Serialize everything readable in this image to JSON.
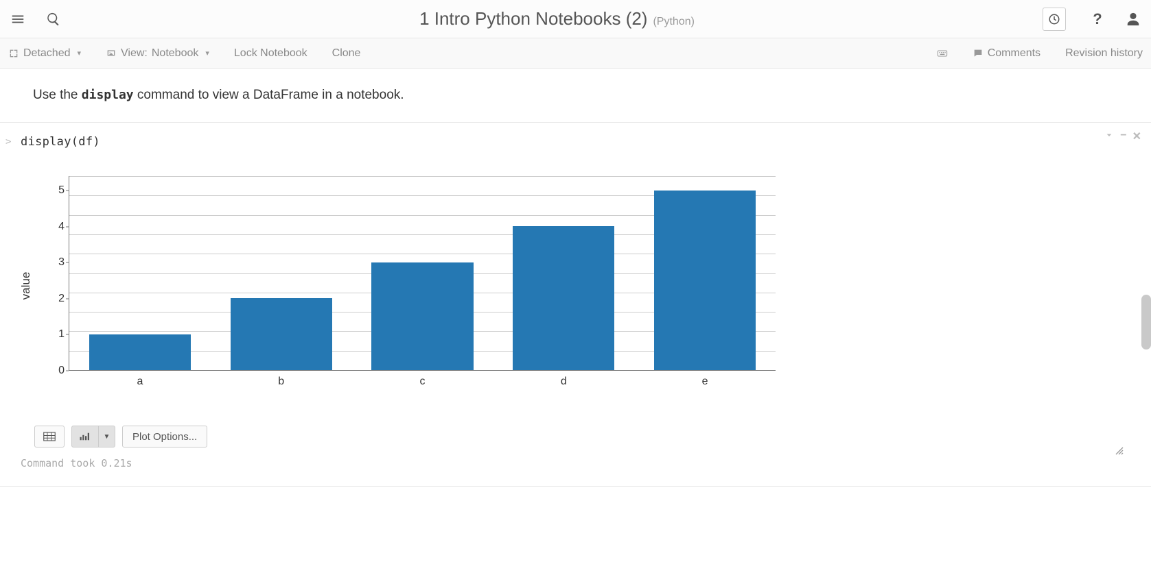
{
  "header": {
    "title": "1 Intro Python Notebooks (2)",
    "language": "(Python)"
  },
  "toolbar": {
    "detached": "Detached",
    "view_prefix": "View:",
    "view_mode": "Notebook",
    "lock": "Lock Notebook",
    "clone": "Clone",
    "comments": "Comments",
    "revision": "Revision history"
  },
  "markdown": {
    "pre": "Use the ",
    "code": "display",
    "post": " command to view a DataFrame in a notebook."
  },
  "cell": {
    "collapse_mark": ">",
    "code": "display(df)",
    "status": "Command took 0.21s",
    "plot_options": "Plot Options..."
  },
  "chart_data": {
    "type": "bar",
    "categories": [
      "a",
      "b",
      "c",
      "d",
      "e"
    ],
    "values": [
      1,
      2,
      3,
      4,
      5
    ],
    "ylabel": "value",
    "ylim": [
      0,
      5.4
    ],
    "yticks": [
      0,
      1,
      2,
      3,
      4,
      5
    ],
    "minor_grid_steps": 10,
    "bar_color": "#2578b3"
  }
}
